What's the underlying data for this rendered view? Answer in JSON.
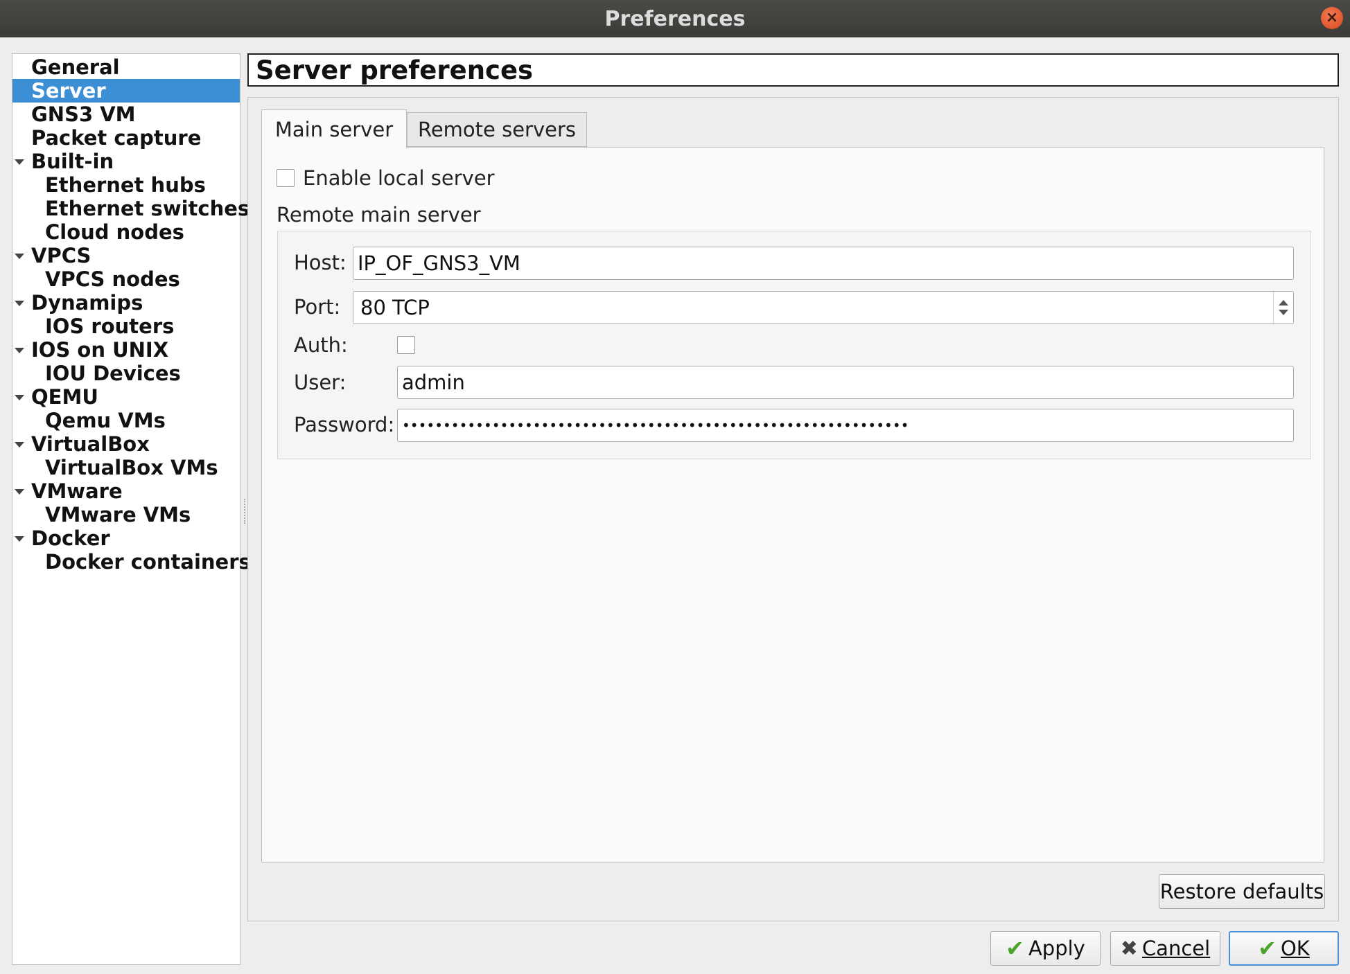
{
  "window": {
    "title": "Preferences",
    "close_icon": "close-icon"
  },
  "sidebar": {
    "items": [
      {
        "label": "General",
        "level": 0,
        "expandable": false,
        "selected": false
      },
      {
        "label": "Server",
        "level": 0,
        "expandable": false,
        "selected": true
      },
      {
        "label": "GNS3 VM",
        "level": 0,
        "expandable": false,
        "selected": false
      },
      {
        "label": "Packet capture",
        "level": 0,
        "expandable": false,
        "selected": false
      },
      {
        "label": "Built-in",
        "level": 0,
        "expandable": true,
        "selected": false
      },
      {
        "label": "Ethernet hubs",
        "level": 1,
        "expandable": false,
        "selected": false
      },
      {
        "label": "Ethernet switches",
        "level": 1,
        "expandable": false,
        "selected": false
      },
      {
        "label": "Cloud nodes",
        "level": 1,
        "expandable": false,
        "selected": false
      },
      {
        "label": "VPCS",
        "level": 0,
        "expandable": true,
        "selected": false
      },
      {
        "label": "VPCS nodes",
        "level": 1,
        "expandable": false,
        "selected": false
      },
      {
        "label": "Dynamips",
        "level": 0,
        "expandable": true,
        "selected": false
      },
      {
        "label": "IOS routers",
        "level": 1,
        "expandable": false,
        "selected": false
      },
      {
        "label": "IOS on UNIX",
        "level": 0,
        "expandable": true,
        "selected": false
      },
      {
        "label": "IOU Devices",
        "level": 1,
        "expandable": false,
        "selected": false
      },
      {
        "label": "QEMU",
        "level": 0,
        "expandable": true,
        "selected": false
      },
      {
        "label": "Qemu VMs",
        "level": 1,
        "expandable": false,
        "selected": false
      },
      {
        "label": "VirtualBox",
        "level": 0,
        "expandable": true,
        "selected": false
      },
      {
        "label": "VirtualBox VMs",
        "level": 1,
        "expandable": false,
        "selected": false
      },
      {
        "label": "VMware",
        "level": 0,
        "expandable": true,
        "selected": false
      },
      {
        "label": "VMware VMs",
        "level": 1,
        "expandable": false,
        "selected": false
      },
      {
        "label": "Docker",
        "level": 0,
        "expandable": true,
        "selected": false
      },
      {
        "label": "Docker containers",
        "level": 1,
        "expandable": false,
        "selected": false
      }
    ]
  },
  "main": {
    "header_title": "Server preferences",
    "tabs": [
      {
        "label": "Main server",
        "active": true
      },
      {
        "label": "Remote servers",
        "active": false
      }
    ],
    "enable_local_server": {
      "label": "Enable local server",
      "checked": false
    },
    "remote_group_title": "Remote main server",
    "host": {
      "label": "Host:",
      "value": "IP_OF_GNS3_VM"
    },
    "port": {
      "label": "Port:",
      "value": "80 TCP"
    },
    "auth": {
      "label": "Auth:",
      "checked": false
    },
    "user": {
      "label": "User:",
      "value": "admin"
    },
    "password": {
      "label": "Password:",
      "value": "••••••••••••••••••••••••••••••••••••••••••••••••••••••••••••••"
    },
    "restore_defaults_label": "Restore defaults"
  },
  "footer": {
    "apply_label": "Apply",
    "cancel_label": "Cancel",
    "ok_label": "OK",
    "accent_color": "#4a90d9"
  }
}
